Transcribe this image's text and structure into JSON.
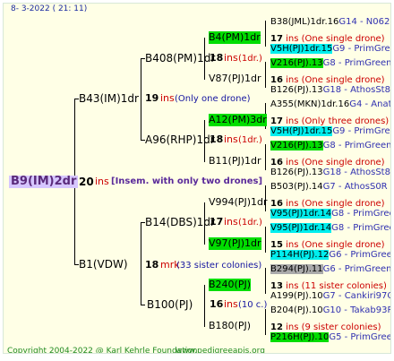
{
  "header": {
    "date": "8-  3-2022 ( 21: 11)"
  },
  "root": {
    "name": "B9(IM)2dr",
    "ins": "20",
    "ins_label": "ins",
    "note": " [Insem. with only two drones]",
    "color": "#d6c6ff"
  },
  "gen2": [
    {
      "name": "B43(IM)1dr"
    },
    {
      "name": "B1(VDW)"
    }
  ],
  "gen3": [
    {
      "name": "B408(PM)1dr",
      "count": "18",
      "unit": "ins",
      "note": " (1dr.)"
    },
    {
      "name": "A96(RHP)1dr",
      "count": "18",
      "unit": "ins",
      "note": " (1dr.)"
    },
    {
      "name": "B14(DBS)1dr",
      "count": "17",
      "unit": "ins",
      "note": " (1dr.)"
    },
    {
      "name": "B100(PJ)",
      "count": "16",
      "unit": "ins",
      "note": " (10 c.)"
    }
  ],
  "gen2_info": [
    {
      "count": "19",
      "unit": "ins",
      "note": "  (Only one drone)"
    },
    {
      "count": "18",
      "unit": "mrk",
      "note": "  (33 sister colonies)"
    }
  ],
  "gen4": [
    {
      "name": "B4(PM)1dr",
      "count": "17",
      "note": " ins (One single drone)"
    },
    {
      "name": "V87(PJ)1dr",
      "count": "16",
      "note": " ins (One single drone)"
    },
    {
      "name": "A12(PM)3dr",
      "count": "17",
      "note": " ins (Only three drones)"
    },
    {
      "name": "B11(PJ)1dr",
      "count": "16",
      "note": " ins (One single drone)"
    },
    {
      "name": "V994(PJ)1dr",
      "count": "16",
      "note": " ins (One single drone)"
    },
    {
      "name": "V97(PJ)1dr",
      "count": "15",
      "note": " ins (One single drone)"
    },
    {
      "name": "B240(PJ)",
      "count": "13",
      "note": " ins (11 sister colonies)"
    },
    {
      "name": "B180(PJ)",
      "count": "12",
      "note": " ins (9 sister colonies)"
    }
  ],
  "gen5": [
    {
      "name": "B38(JML)1dr.16",
      "tail": "G14 - N06294R"
    },
    {
      "name": "V5H(PJ)1dr.15",
      "tail": "G9 - PrimGreen00"
    },
    {
      "name": "V216(PJ).13",
      "tail": "G8 - PrimGreen00"
    },
    {
      "name": "B126(PJ).13",
      "tail": "G18 - AthosSt80R"
    },
    {
      "name": "A355(MKN)1dr.16",
      "tail": "G4 - Anat11Q"
    },
    {
      "name": "V5H(PJ)1dr.15",
      "tail": "G9 - PrimGreen00"
    },
    {
      "name": "V216(PJ).13",
      "tail": "G8 - PrimGreen00"
    },
    {
      "name": "B126(PJ).13",
      "tail": "G18 - AthosSt80R"
    },
    {
      "name": "B503(PJ).14",
      "tail": "G7 - AthosS0R"
    },
    {
      "name": "V95(PJ)1dr.14",
      "tail": "G8 - PrimGreen00"
    },
    {
      "name": "V95(PJ)1dr.14",
      "tail": "G8 - PrimGreen00"
    },
    {
      "name": "P114H(PJ).12",
      "tail": "G6 - PrimGreen00"
    },
    {
      "name": "B294(PJ).11",
      "tail": "G6 - PrimGreen00"
    },
    {
      "name": "A199(PJ).10",
      "tail": "G7 - Cankiri97Q"
    },
    {
      "name": "B204(PJ).10",
      "tail": "G10 - Takab93R"
    },
    {
      "name": "P216H(PJ).10",
      "tail": "G5 - PrimGreen00"
    }
  ],
  "footer": {
    "copyright": "Copyright 2004-2022 @ Karl Kehrle Foundation",
    "site": "www.pedigreeapis.org"
  },
  "colors": {
    "green": "#00dd00",
    "cyan": "#00eeee",
    "grey": "#aaaaaa",
    "root_bg": "#d6c6ff"
  }
}
